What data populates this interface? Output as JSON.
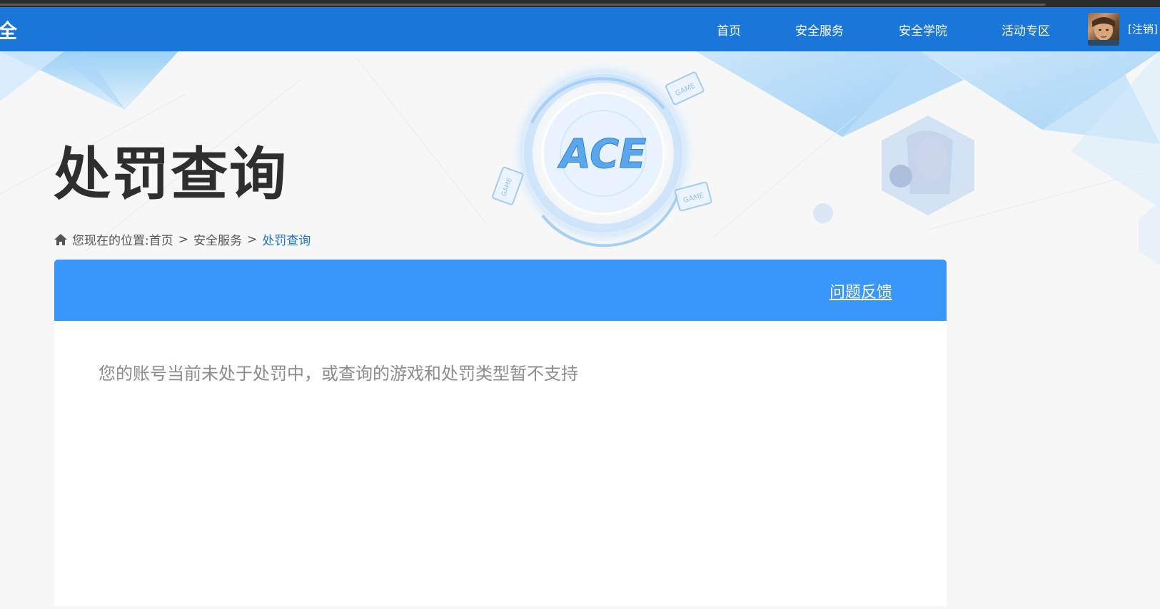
{
  "header": {
    "brand": "全",
    "nav": [
      "首页",
      "安全服务",
      "安全学院",
      "活动专区"
    ],
    "logout": "[注销]"
  },
  "hero": {
    "title": "处罚查询",
    "logo_text": "ACE",
    "badge_text": "GAME"
  },
  "breadcrumb": {
    "prefix": "您现在的位置:",
    "items": [
      "首页",
      "安全服务",
      "处罚查询"
    ],
    "separator": ">"
  },
  "panel": {
    "feedback_label": "问题反馈",
    "message": "您的账号当前未处于处罚中，或查询的游戏和处罚类型暂不支持"
  },
  "colors": {
    "navbar": "#1a76d8",
    "panel_header": "#3997fb",
    "link_current": "#1a76d8"
  }
}
